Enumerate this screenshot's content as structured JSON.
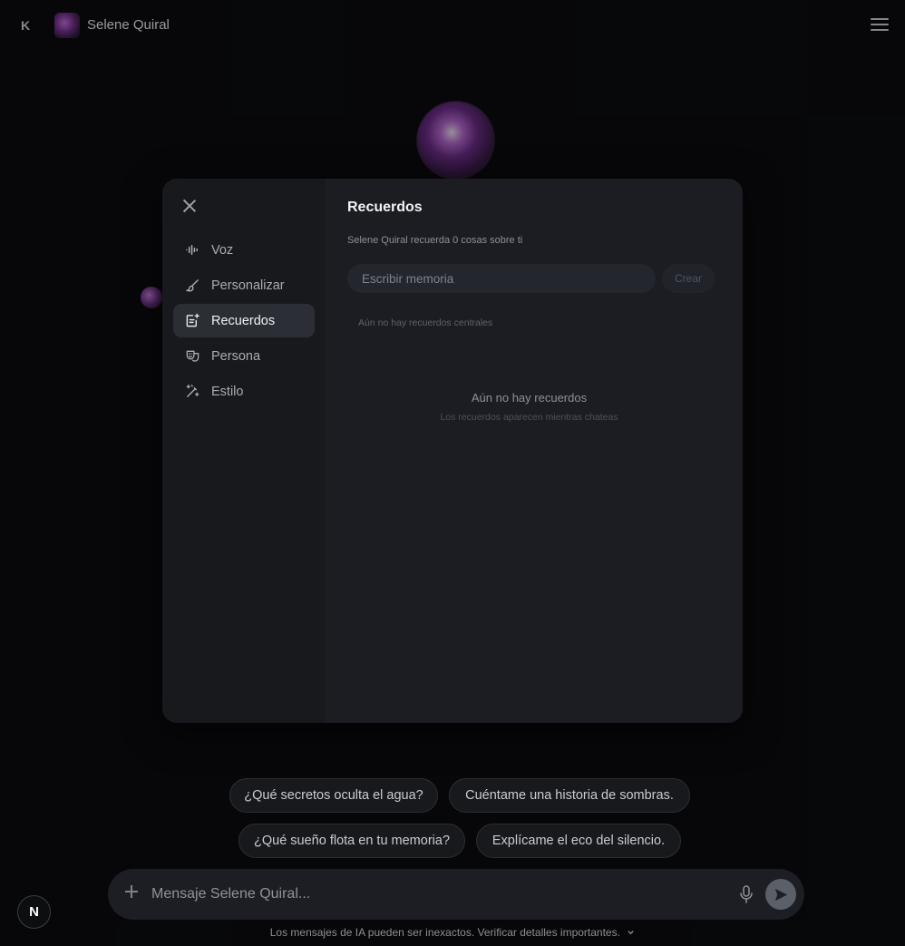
{
  "header": {
    "logo": "K",
    "character_name": "Selene Quiral"
  },
  "modal": {
    "nav": [
      {
        "label": "Voz",
        "icon": "voice-wave-icon"
      },
      {
        "label": "Personalizar",
        "icon": "brush-icon"
      },
      {
        "label": "Recuerdos",
        "icon": "memory-note-icon",
        "active": true
      },
      {
        "label": "Persona",
        "icon": "theater-mask-icon"
      },
      {
        "label": "Estilo",
        "icon": "magic-wand-icon"
      }
    ],
    "title": "Recuerdos",
    "subtitle": "Selene Quiral recuerda 0 cosas sobre ti",
    "input_placeholder": "Escribir memoria",
    "create_label": "Crear",
    "no_core": "Aún no hay recuerdos centrales",
    "empty_title": "Aún no hay recuerdos",
    "empty_sub": "Los recuerdos aparecen mientras chateas"
  },
  "suggestions": [
    "¿Qué secretos oculta el agua?",
    "Cuéntame una historia de sombras.",
    "¿Qué sueño flota en tu memoria?",
    "Explícame el eco del silencio."
  ],
  "composer": {
    "placeholder": "Mensaje Selene Quiral..."
  },
  "footer": {
    "note": "Los mensajes de IA pueden ser inexactos. Verificar detalles importantes."
  },
  "badge": "N",
  "colors": {
    "background": "#0b0c0e",
    "modal": "#1a1c21",
    "active_nav": "#2b2e35",
    "avatar_accent": "#b067c9"
  }
}
